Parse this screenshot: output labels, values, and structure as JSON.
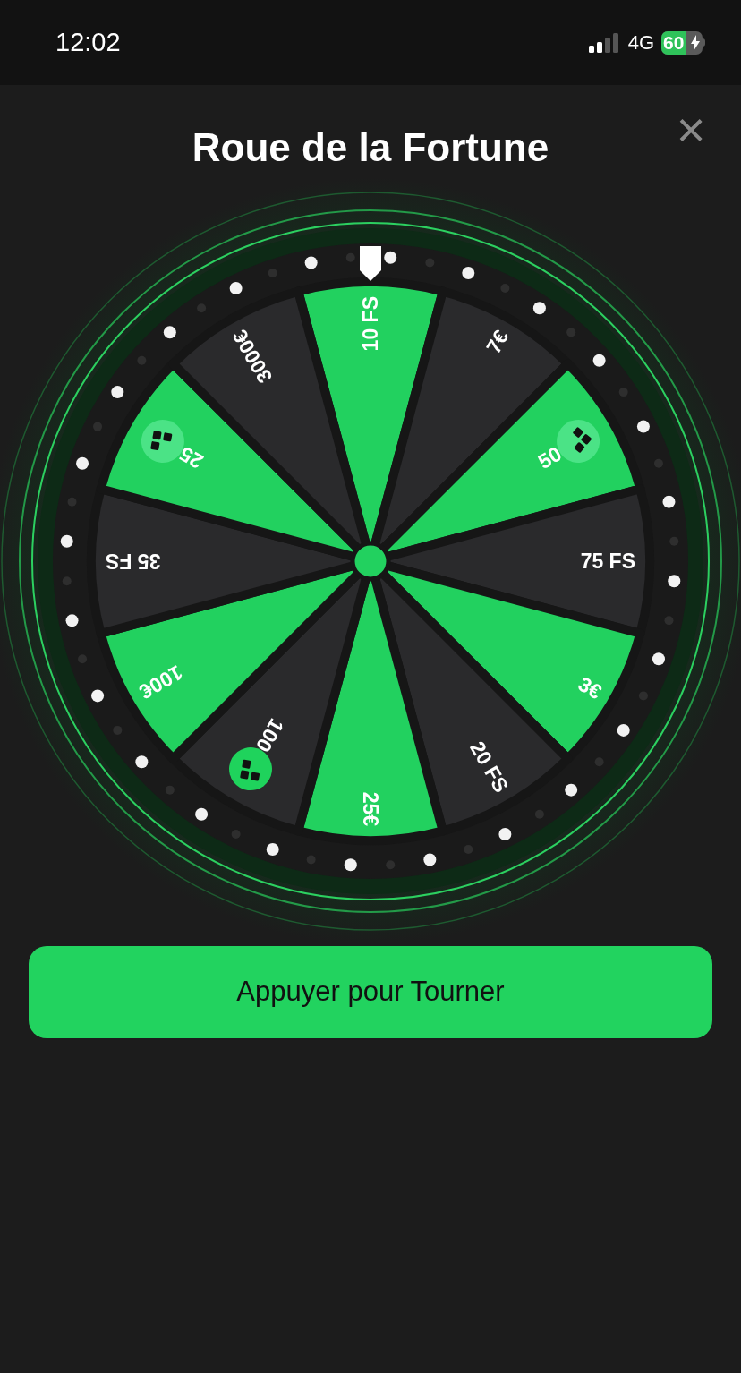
{
  "status_bar": {
    "time": "12:02",
    "network": "4G",
    "battery": "60"
  },
  "title": "Roue de la Fortune",
  "close": "×",
  "wheel": {
    "segments": [
      {
        "label": "10 FS",
        "color": "#22d15f",
        "kind": "plain"
      },
      {
        "label": "7€",
        "color": "#2a2a2c",
        "kind": "plain"
      },
      {
        "label": "50",
        "color": "#22d15f",
        "kind": "token"
      },
      {
        "label": "75 FS",
        "color": "#2a2a2c",
        "kind": "plain"
      },
      {
        "label": "3€",
        "color": "#22d15f",
        "kind": "plain"
      },
      {
        "label": "20 FS",
        "color": "#2a2a2c",
        "kind": "plain"
      },
      {
        "label": "25€",
        "color": "#22d15f",
        "kind": "plain"
      },
      {
        "label": "100",
        "color": "#2a2a2c",
        "kind": "token"
      },
      {
        "label": "100€",
        "color": "#22d15f",
        "kind": "plain"
      },
      {
        "label": "35 FS",
        "color": "#2a2a2c",
        "kind": "plain"
      },
      {
        "label": "25",
        "color": "#22d15f",
        "kind": "token"
      },
      {
        "label": "3000€",
        "color": "#2a2a2c",
        "kind": "plain"
      }
    ]
  },
  "spin_button": "Appuyer pour Tourner"
}
